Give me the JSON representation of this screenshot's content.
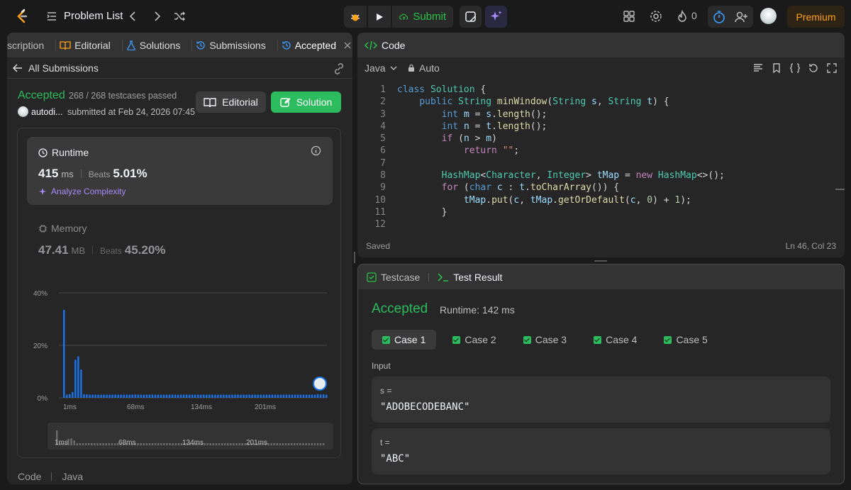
{
  "topbar": {
    "title": "Problem List",
    "submit_label": "Submit",
    "streak": "0",
    "premium_label": "Premium"
  },
  "left": {
    "tabs": [
      "scription",
      "Editorial",
      "Solutions",
      "Submissions",
      "Accepted"
    ],
    "back_label": "All Submissions",
    "status": "Accepted",
    "testcases": "268 / 268 testcases passed",
    "username": "autodi...",
    "submitted": "submitted at Feb 24, 2026 07:45",
    "editorial_btn": "Editorial",
    "solution_btn": "Solution",
    "runtime": {
      "title": "Runtime",
      "value": "415",
      "unit": "ms",
      "beats_label": "Beats",
      "beats": "5.01%",
      "analyze": "Analyze Complexity"
    },
    "memory": {
      "title": "Memory",
      "value": "47.41",
      "unit": "MB",
      "beats_label": "Beats",
      "beats": "45.20%"
    },
    "footer_code": "Code",
    "footer_lang": "Java"
  },
  "chart_data": {
    "type": "bar",
    "yticks": [
      "40%",
      "20%",
      "0%"
    ],
    "xticks": [
      "1ms",
      "68ms",
      "134ms",
      "201ms"
    ],
    "ylim": [
      0,
      40
    ],
    "values": [
      33.5,
      1.2,
      1.4,
      2.2,
      14.5,
      15.8,
      10.8,
      1.4,
      1.3,
      1.2,
      1.2,
      1.2,
      1.2,
      1.2,
      1.2,
      1.2,
      1.2,
      1.2,
      1.2,
      1.2,
      1.2,
      1.2,
      1.2,
      1.2,
      1.2,
      1.2,
      1.2,
      1.2,
      1.2,
      1.2,
      1.2,
      1.2,
      1.2,
      1.2,
      1.2,
      1.2,
      1.2,
      1.2,
      1.2,
      1.2,
      1.2,
      1.2,
      1.2,
      1.2,
      1.2,
      1.2,
      1.2,
      1.2,
      1.2,
      1.2,
      1.2,
      1.2,
      1.2,
      1.2,
      1.2,
      1.2,
      1.2,
      1.2,
      1.2,
      1.2,
      1.2,
      1.2,
      1.2,
      1.2,
      1.2,
      1.2,
      1.2,
      1.2,
      1.2,
      1.2,
      1.2,
      1.2,
      1.2,
      1.2,
      1.2,
      1.2,
      1.2,
      1.2,
      1.2,
      1.2,
      1.2,
      1.2,
      1.2,
      1.2,
      1.2,
      1.2,
      1.2,
      1.2,
      1.2,
      1.4,
      1.3,
      1.3,
      1.2
    ],
    "bar_color": "#1a73e8",
    "grid": true
  },
  "code": {
    "title": "Code",
    "language": "Java",
    "mode": "Auto",
    "saved": "Saved",
    "position": "Ln 46, Col 23"
  },
  "result": {
    "tab_testcase": "Testcase",
    "tab_result": "Test Result",
    "status": "Accepted",
    "runtime": "Runtime: 142 ms",
    "cases": [
      "Case 1",
      "Case 2",
      "Case 3",
      "Case 4",
      "Case 5"
    ],
    "input_label": "Input",
    "vars": [
      {
        "name": "s =",
        "value": "\"ADOBECODEBANC\""
      },
      {
        "name": "t =",
        "value": "\"ABC\""
      }
    ]
  },
  "colors": {
    "accent": "#2cbb5d",
    "premium": "#ffa116",
    "bar": "#1a73e8"
  }
}
